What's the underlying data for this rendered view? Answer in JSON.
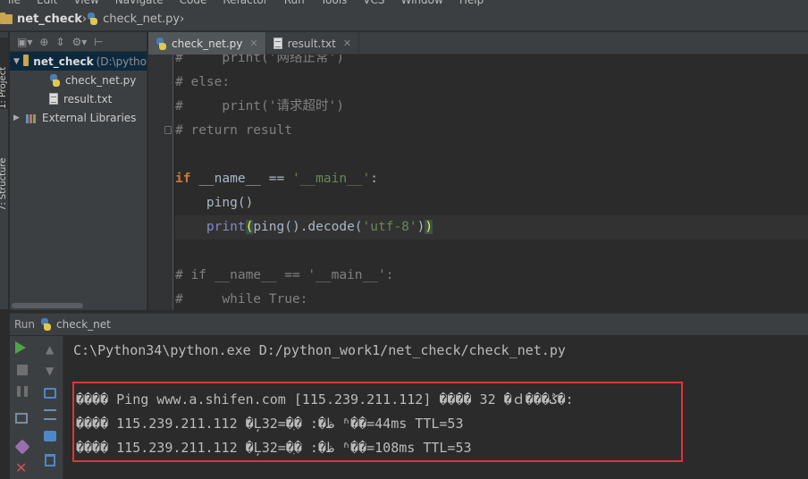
{
  "menubar": {
    "items": [
      "ile",
      "Edit",
      "View",
      "Navigate",
      "Code",
      "Refactor",
      "Run",
      "Tools",
      "VCS",
      "Window",
      "Help"
    ]
  },
  "breadcrumb": {
    "project": "net_check",
    "file": "check_net.py"
  },
  "left_strip": {
    "project_tab": "1: Project",
    "structure_tab": "7: Structure"
  },
  "project_tree": {
    "root_name": "net_check",
    "root_path": "(D:\\pytho",
    "files": [
      "check_net.py",
      "result.txt"
    ],
    "libraries": "External Libraries"
  },
  "editor": {
    "tabs": [
      {
        "label": "check_net.py",
        "active": true
      },
      {
        "label": "result.txt",
        "active": false
      }
    ],
    "lines": [
      {
        "kind": "comment",
        "text": "#     print('网络正常')"
      },
      {
        "kind": "comment",
        "text": "# else:"
      },
      {
        "kind": "comment",
        "text": "#     print('请求超时')"
      },
      {
        "kind": "comment",
        "text": "# return result"
      },
      {
        "kind": "blank",
        "text": ""
      },
      {
        "kind": "if",
        "kw": "if",
        "name": "__name__",
        "op": " == ",
        "str": "'__main__'",
        "tail": ":"
      },
      {
        "kind": "call",
        "text": "    ping()"
      },
      {
        "kind": "print",
        "indent": "    ",
        "fn": "print",
        "open": "(",
        "mid": "ping().decode(",
        "str": "'utf-8'",
        "close1": ")",
        "close2": ")"
      },
      {
        "kind": "blank",
        "text": ""
      },
      {
        "kind": "comment",
        "text": "# if __name__ == '__main__':"
      },
      {
        "kind": "comment",
        "text": "#     while True:"
      }
    ]
  },
  "run_panel": {
    "label": "Run",
    "config": "check_net",
    "command": "C:\\Python34\\python.exe D:/python_work1/net_check/check_net.py",
    "output": [
      "���� Ping www.a.shifen.com [115.239.211.112] ���� 32 �ｄ���ݣ�:",
      "���� 115.239.211.112 �Ļظ�: �ֽ�=32 ʱ��=44ms TTL=53",
      "���� 115.239.211.112 �Ļظ�: �ֽ�=32 ʱ��=108ms TTL=53"
    ]
  },
  "colors": {
    "highlight_box": "#e03535",
    "run_green": "#4fa34b"
  }
}
